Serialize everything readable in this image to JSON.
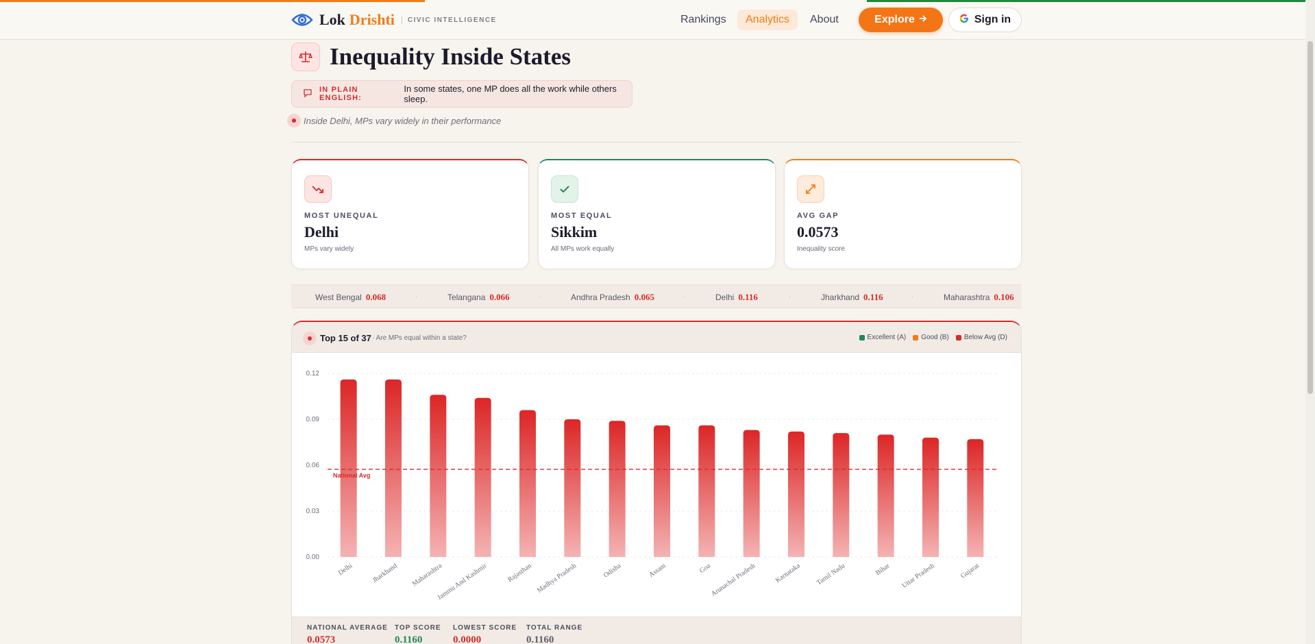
{
  "header": {
    "brand_first": "Lok",
    "brand_second": "Drishti",
    "tagline": "CIVIC INTELLIGENCE",
    "nav": [
      "Rankings",
      "Analytics",
      "About"
    ],
    "active_nav": "Analytics",
    "explore_label": "Explore",
    "signin_label": "Sign in"
  },
  "page": {
    "title": "Inequality Inside States",
    "plain_label": "IN PLAIN ENGLISH:",
    "plain_text": "In some states, one MP does all the work while others sleep.",
    "note": "Inside Delhi, MPs vary widely in their performance"
  },
  "cards": [
    {
      "label": "MOST UNEQUAL",
      "value": "Delhi",
      "desc": "MPs vary widely",
      "accent": "#d62b2b",
      "icon": "trending-down-icon"
    },
    {
      "label": "MOST EQUAL",
      "value": "Sikkim",
      "desc": "All MPs work equally",
      "accent": "#1f8a5a",
      "icon": "check-icon"
    },
    {
      "label": "AVG GAP",
      "value": "0.0573",
      "desc": "Inequality score",
      "accent": "#f07c18",
      "icon": "expand-arrows-icon"
    }
  ],
  "ticker": [
    {
      "state": "West Bengal",
      "value": "0.068"
    },
    {
      "state": "Telangana",
      "value": "0.066"
    },
    {
      "state": "Andhra Pradesh",
      "value": "0.065"
    },
    {
      "state": "Delhi",
      "value": "0.116"
    },
    {
      "state": "Jharkhand",
      "value": "0.116"
    },
    {
      "state": "Maharashtra",
      "value": "0.106"
    }
  ],
  "panel": {
    "title": "Top 15 of 37",
    "subtitle": "Are MPs equal within a state?",
    "legend": [
      {
        "label": "Excellent (A)",
        "color": "#1f8a5a"
      },
      {
        "label": "Good (B)",
        "color": "#f07c18"
      },
      {
        "label": "Below Avg (D)",
        "color": "#d62b2b"
      }
    ]
  },
  "chart_data": {
    "type": "bar",
    "categories": [
      "Delhi",
      "Jharkhand",
      "Maharashtra",
      "Jammu And Kashmir",
      "Rajasthan",
      "Madhya Pradesh",
      "Odisha",
      "Assam",
      "Goa",
      "Arunachal Pradesh",
      "Karnataka",
      "Tamil Nadu",
      "Bihar",
      "Uttar Pradesh",
      "Gujarat"
    ],
    "values": [
      0.116,
      0.116,
      0.106,
      0.104,
      0.096,
      0.09,
      0.089,
      0.086,
      0.086,
      0.083,
      0.082,
      0.081,
      0.08,
      0.078,
      0.077
    ],
    "ylim": [
      0,
      0.12
    ],
    "yticks": [
      "0.00",
      "0.03",
      "0.06",
      "0.09",
      "0.12"
    ],
    "reference_line": {
      "label": "National Avg",
      "value": 0.0573
    },
    "bar_color": "#d62b2b",
    "grid": true
  },
  "footer": [
    {
      "label": "NATIONAL AVERAGE",
      "value": "0.0573",
      "color": "#d62b2b"
    },
    {
      "label": "TOP SCORE",
      "value": "0.1160",
      "color": "#1f8a5a"
    },
    {
      "label": "LOWEST SCORE",
      "value": "0.0000",
      "color": "#d62b2b"
    },
    {
      "label": "TOTAL RANGE",
      "value": "0.1160",
      "color": "#5b5e6a"
    }
  ]
}
